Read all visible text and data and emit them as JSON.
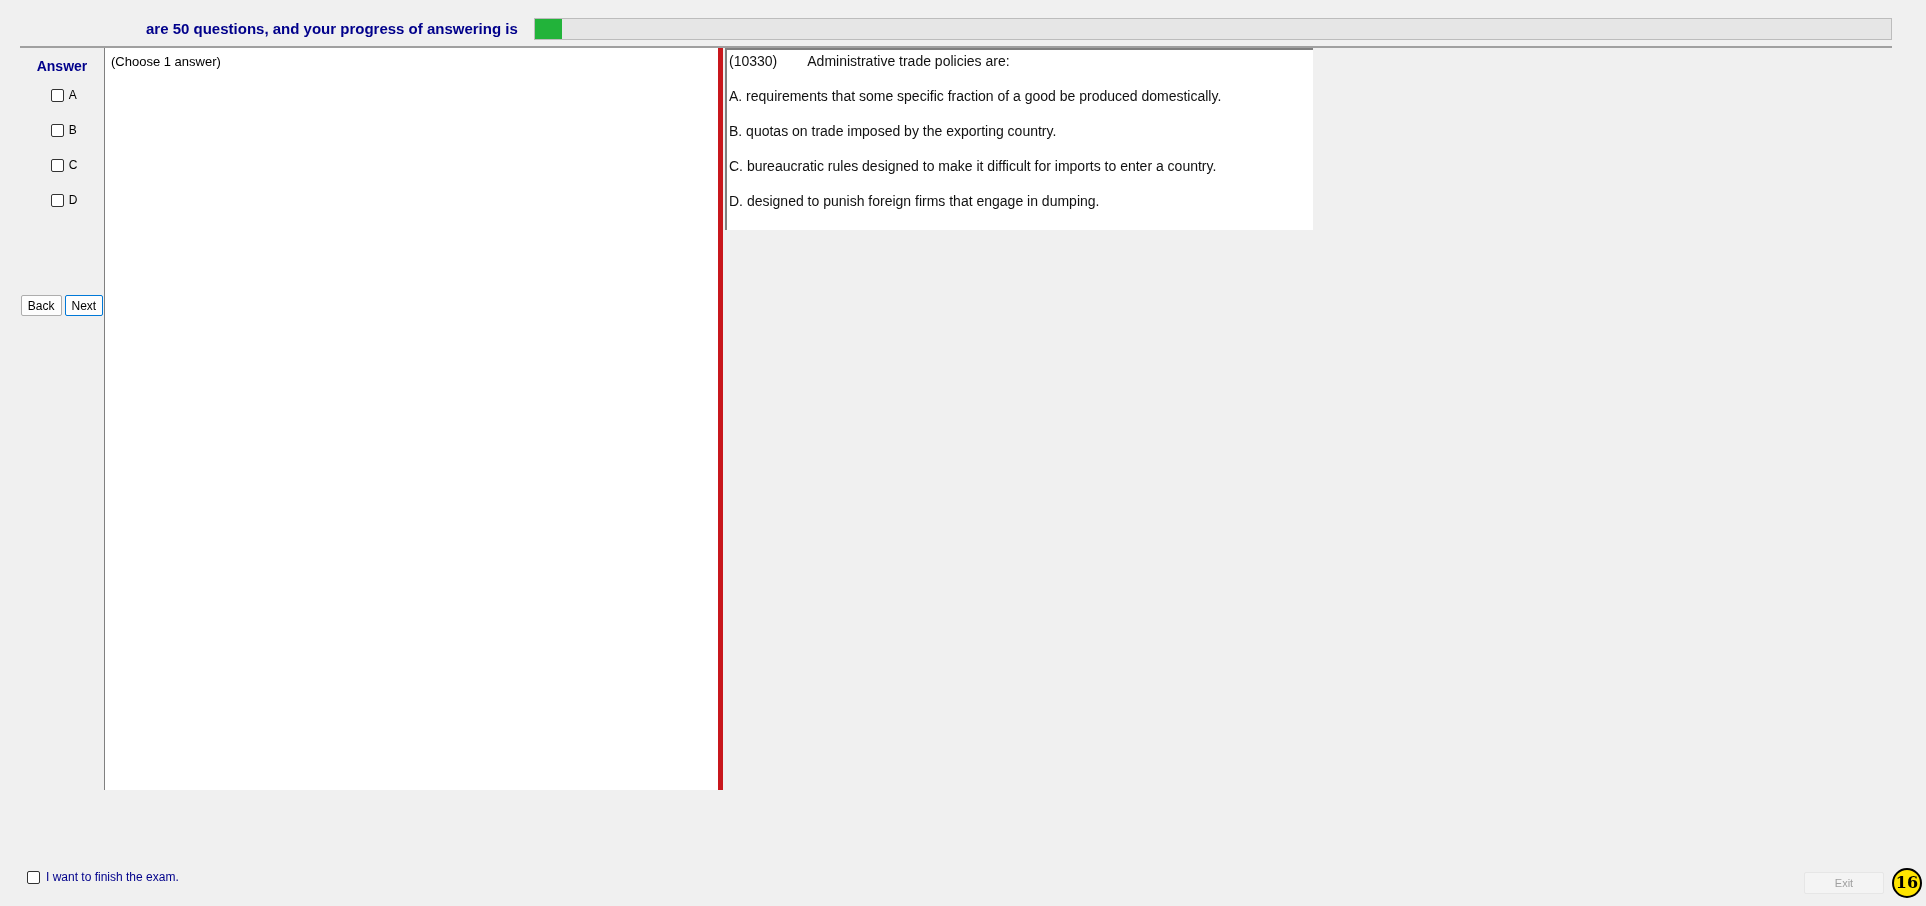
{
  "header": {
    "text": "are 50 questions, and your progress of answering is",
    "progress": {
      "level": 0.02
    }
  },
  "answer_panel": {
    "title": "Answer",
    "options": [
      {
        "label": "A",
        "checked": false
      },
      {
        "label": "B",
        "checked": false
      },
      {
        "label": "C",
        "checked": false
      },
      {
        "label": "D",
        "checked": false
      }
    ],
    "buttons": [
      {
        "label": "Back",
        "focused": false
      },
      {
        "label": "Next",
        "focused": true
      }
    ]
  },
  "answer_area": {
    "hint": "(Choose 1 answer)"
  },
  "question": {
    "number": "(10330)",
    "text": "Administrative trade policies are:",
    "choices": [
      "A.  requirements that some specific fraction of a good be produced domestically.",
      "B.  quotas on trade imposed by the exporting country.",
      "C.  bureaucratic rules designed to make it difficult for imports to enter a country.",
      "D.  designed to punish foreign firms that engage in dumping."
    ]
  },
  "finish": {
    "label": "I want to finish the exam.",
    "checked": false
  },
  "exit_button": {
    "label": "Exit",
    "disabled": true
  },
  "badge": "16"
}
